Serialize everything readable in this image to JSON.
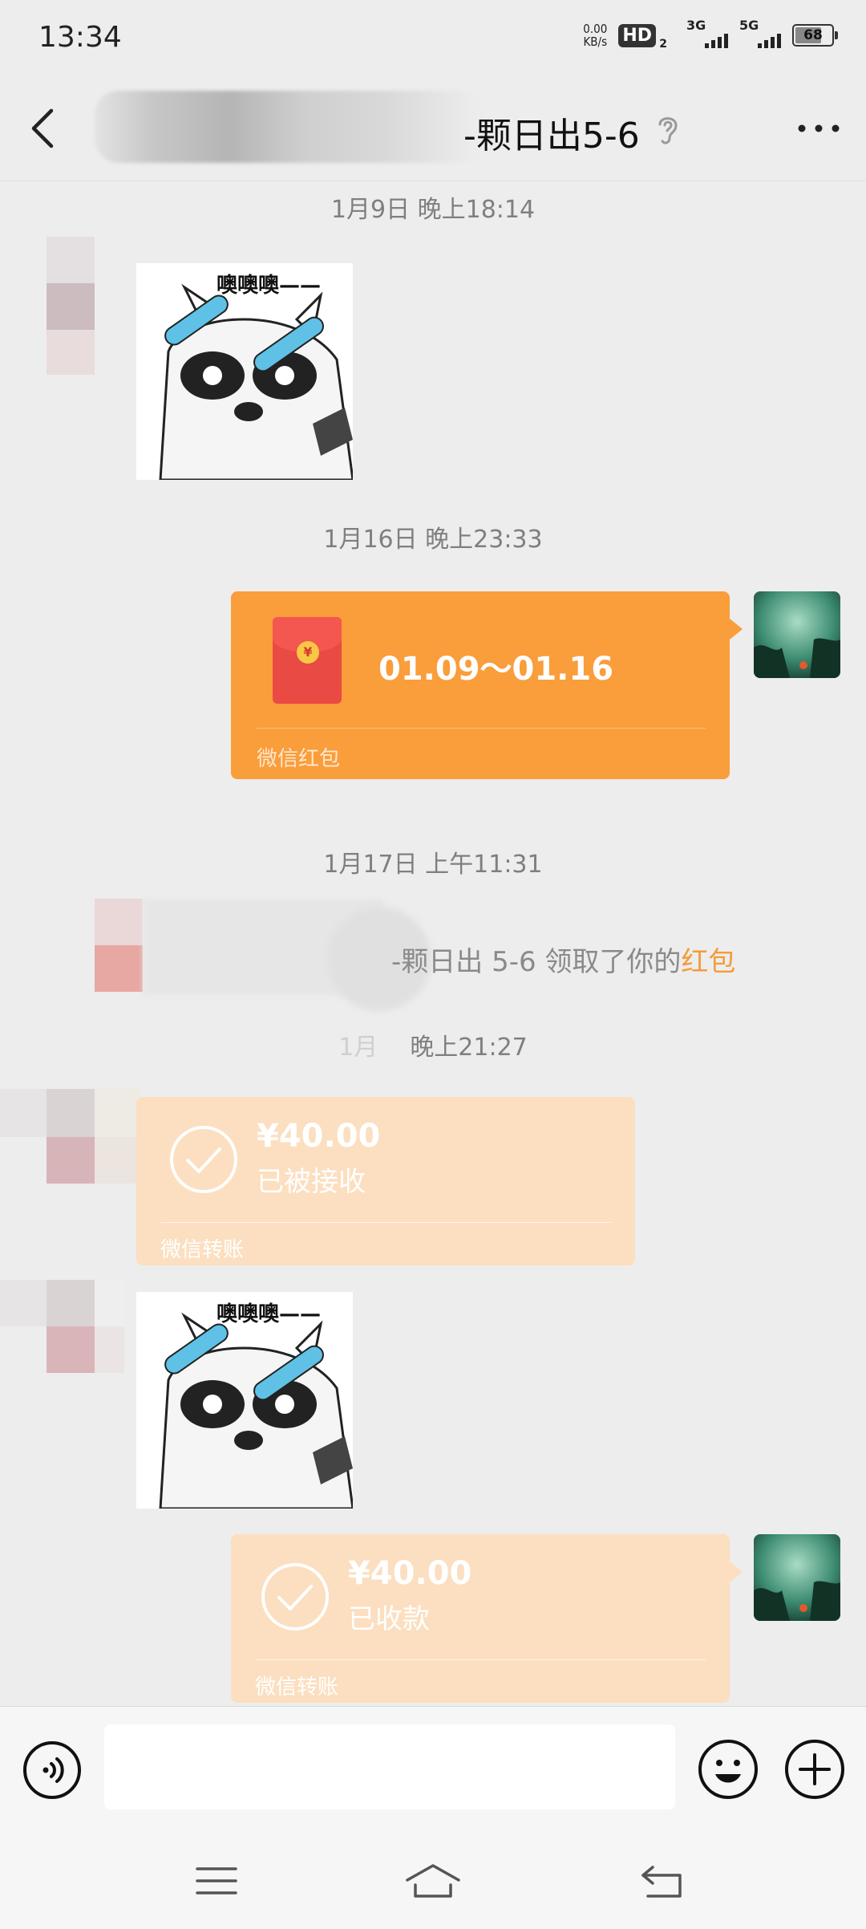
{
  "status_bar": {
    "time": "13:34",
    "net_speed_value": "0.00",
    "net_speed_unit": "KB/s",
    "hd_badge": "HD",
    "hd_sub": "2",
    "signal1_label": "3G",
    "signal2_label": "5G",
    "battery_level": "68"
  },
  "header": {
    "title_suffix": "-颗日出5-6",
    "icons": [
      "back-icon",
      "ear-icon",
      "more-icon"
    ]
  },
  "messages": {
    "ts1": "1月9日 晚上18:14",
    "ts2": "1月16日 晚上23:33",
    "red_packet": {
      "text": "01.09～01.16",
      "footer": "微信红包",
      "coin": "¥"
    },
    "ts3": "1月17日 上午11:31",
    "system_msg": {
      "text": "-颗日出 5-6 领取了你的",
      "link": "红包"
    },
    "ts4": "晚上21:27",
    "transfer1": {
      "amount": "¥40.00",
      "status": "已被接收",
      "footer": "微信转账"
    },
    "transfer2": {
      "amount": "¥40.00",
      "status": "已收款",
      "footer": "微信转账"
    },
    "sticker_caption": "噢噢噢——"
  },
  "input_bar": {
    "icons": [
      "voice-icon",
      "emoji-icon",
      "plus-icon"
    ]
  },
  "nav_bar": {
    "icons": [
      "menu-icon",
      "home-icon",
      "return-icon"
    ]
  },
  "colors": {
    "background": "#ededed",
    "red_packet": "#fa9d3b",
    "transfer_received": "#fbdfc0",
    "link": "#f39c3a"
  }
}
